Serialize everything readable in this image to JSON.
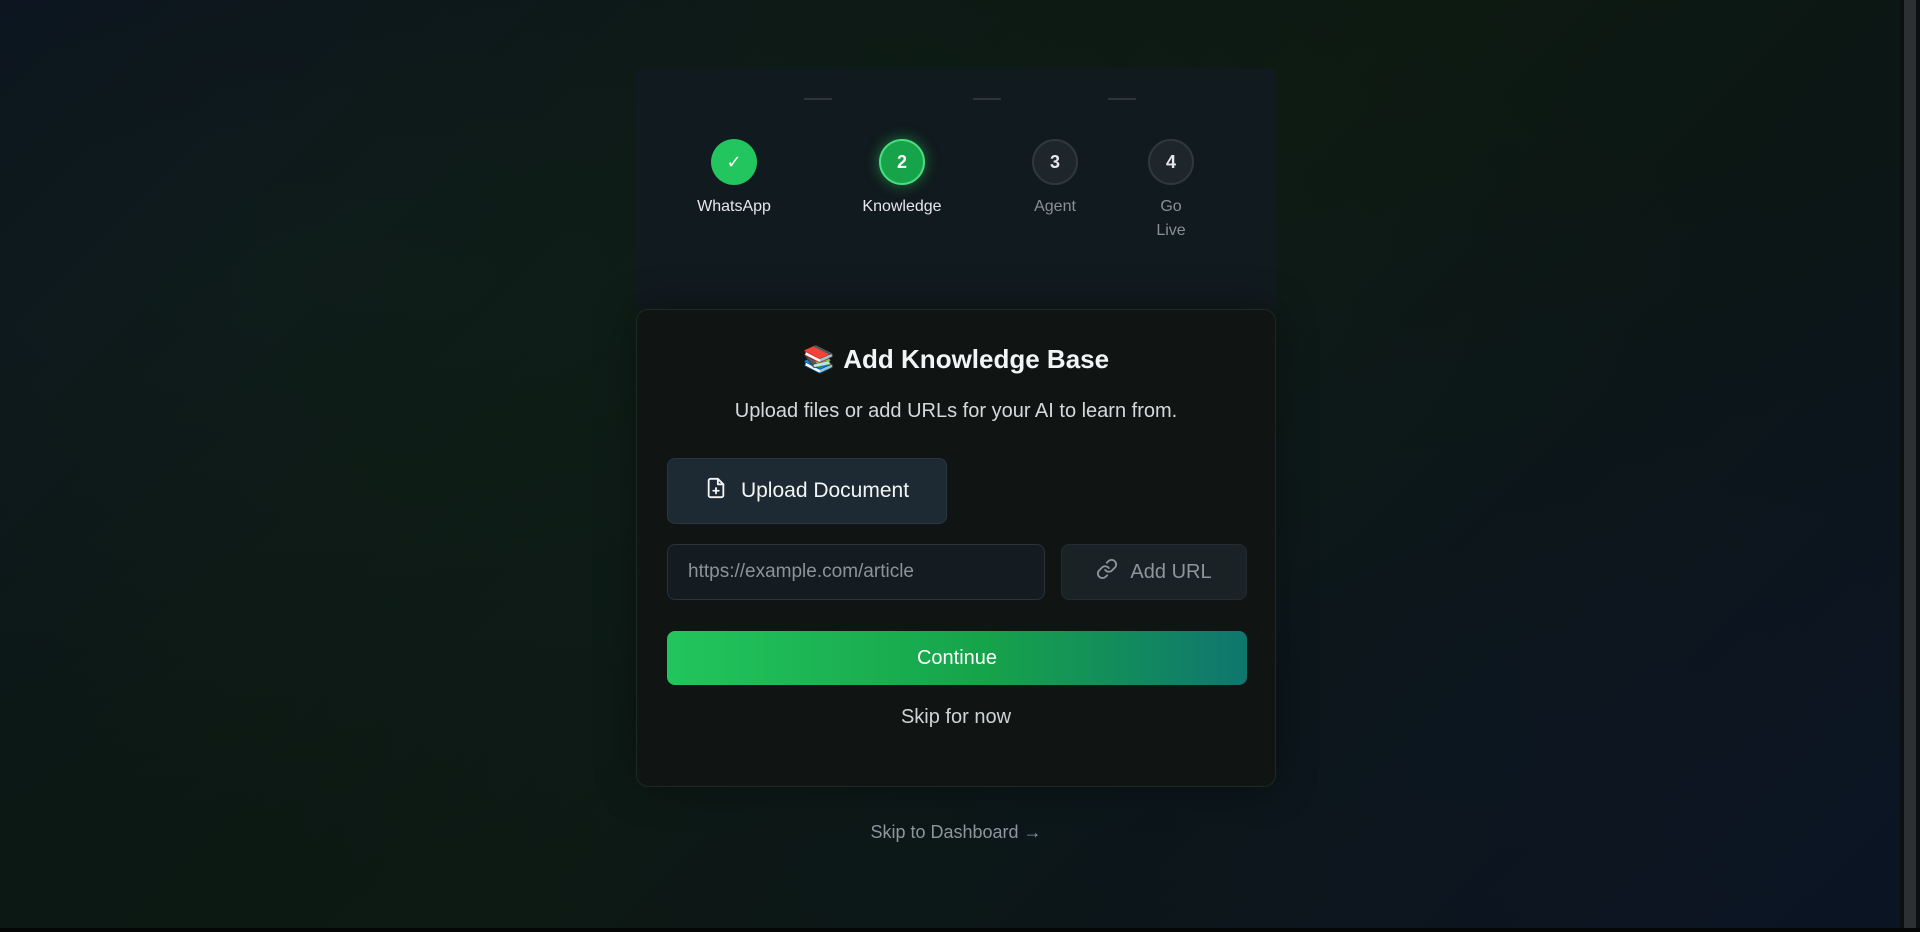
{
  "stepper": {
    "steps": [
      {
        "number": "✓",
        "label": "WhatsApp",
        "state": "done"
      },
      {
        "number": "2",
        "label": "Knowledge",
        "state": "active"
      },
      {
        "number": "3",
        "label": "Agent",
        "state": "pending"
      },
      {
        "number": "4",
        "label": "Go Live",
        "state": "pending"
      }
    ]
  },
  "card": {
    "icon": "📚",
    "title": "Add Knowledge Base",
    "subtitle": "Upload files or add URLs for your AI to learn from.",
    "upload_label": "Upload Document",
    "url_placeholder": "https://example.com/article",
    "url_value": "",
    "add_url_label": "Add URL",
    "continue_label": "Continue",
    "skip_now_label": "Skip for now"
  },
  "footer": {
    "skip_dashboard_label": "Skip to Dashboard →"
  },
  "colors": {
    "accent": "#22c55e",
    "accent_dark": "#0f766e",
    "card_bg": "#101513",
    "panel_bg": "#111a1e"
  }
}
